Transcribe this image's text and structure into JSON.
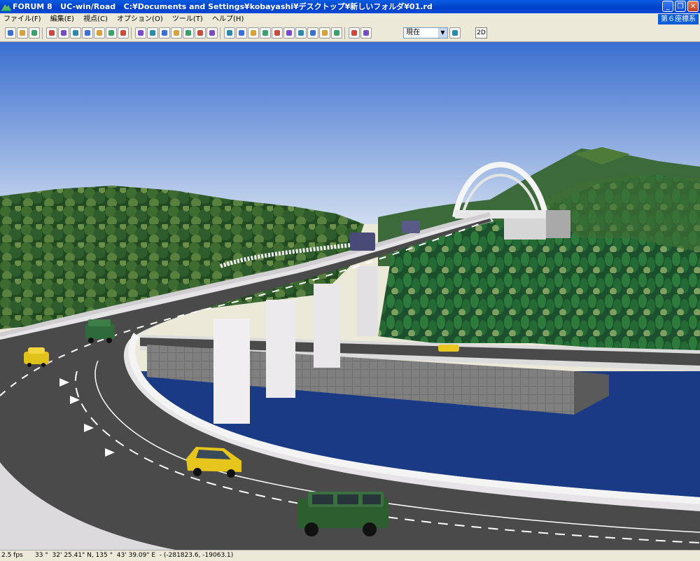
{
  "window": {
    "title": "FORUM 8   UC-win/Road   C:¥Documents and Settings¥kobayashi¥デスクトップ¥新しいフォルダ¥01.rd",
    "minimize": "_",
    "restore": "❐",
    "close": "✕"
  },
  "menu": [
    "ファイル(F)",
    "編集(E)",
    "視点(C)",
    "オプション(O)",
    "ツール(T)",
    "ヘルプ(H)"
  ],
  "coord_system": "第６座標系",
  "toolbar": {
    "time_select_value": "現在",
    "btn_2d": "2D",
    "icons": [
      "new-file-icon",
      "open-folder-icon",
      "save-icon",
      "edit-road-icon",
      "cross-section-icon",
      "intersection-icon",
      "pedestrian-icon",
      "walk-icon",
      "tree-icon",
      "model-icon",
      "sign-icon",
      "terrain-icon",
      "texture-icon",
      "car-icon",
      "rotate-icon",
      "plant-icon",
      "flag-icon",
      "target-icon",
      "anchor-icon",
      "move-icon",
      "plane-icon",
      "refresh-icon",
      "drive-icon",
      "person-icon",
      "pause-icon",
      "vehicle-icon",
      "fly-icon",
      "weather-icon",
      "traffic-light-icon",
      "scenario-icon"
    ]
  },
  "status": {
    "fps": "2.5 fps",
    "coords": "33 °  32' 25.41\" N, 135 °  43' 39.09\" E  - (-281823.6, -19063.1)"
  },
  "colors": {
    "title_blue": "#0a4ad8",
    "sky_top": "#3b6fd0",
    "sky_bottom": "#c9d9ef",
    "water": "#1a3a8a",
    "forest": "#2a5a2a"
  }
}
